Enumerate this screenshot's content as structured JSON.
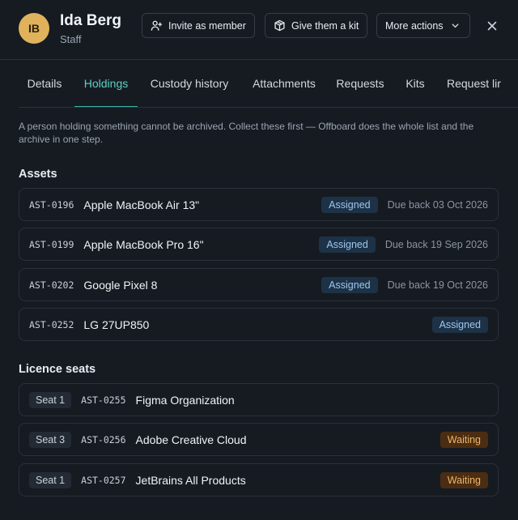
{
  "person": {
    "initials": "IB",
    "name": "Ida Berg",
    "role": "Staff"
  },
  "header": {
    "invite_label": "Invite as member",
    "kit_label": "Give them a kit",
    "more_label": "More actions"
  },
  "tabs": [
    {
      "label": "Details",
      "active": false
    },
    {
      "label": "Holdings",
      "active": true
    },
    {
      "label": "Custody history",
      "active": false
    },
    {
      "label": "Attachments",
      "active": false
    },
    {
      "label": "Requests",
      "active": false
    },
    {
      "label": "Kits",
      "active": false
    },
    {
      "label": "Request lir",
      "active": false
    }
  ],
  "notice": "A person holding something cannot be archived. Collect these first — Offboard does the whole list and the archive in one step.",
  "assets": {
    "title": "Assets",
    "items": [
      {
        "code": "AST-0196",
        "name": "Apple MacBook Air 13\"",
        "status": "Assigned",
        "due": "Due back 03 Oct 2026"
      },
      {
        "code": "AST-0199",
        "name": "Apple MacBook Pro 16\"",
        "status": "Assigned",
        "due": "Due back 19 Sep 2026"
      },
      {
        "code": "AST-0202",
        "name": "Google Pixel 8",
        "status": "Assigned",
        "due": "Due back 19 Oct 2026"
      },
      {
        "code": "AST-0252",
        "name": "LG 27UP850",
        "status": "Assigned",
        "due": ""
      }
    ]
  },
  "licences": {
    "title": "Licence seats",
    "items": [
      {
        "seat": "Seat 1",
        "code": "AST-0255",
        "name": "Figma Organization",
        "status": ""
      },
      {
        "seat": "Seat 3",
        "code": "AST-0256",
        "name": "Adobe Creative Cloud",
        "status": "Waiting"
      },
      {
        "seat": "Seat 1",
        "code": "AST-0257",
        "name": "JetBrains All Products",
        "status": "Waiting"
      }
    ]
  },
  "colors": {
    "accent": "#3fb3a8",
    "assigned_badge": "#1d3247",
    "waiting_badge": "#4a2d12",
    "avatar": "#e0b25c"
  },
  "icons": {
    "invite": "user-plus-icon",
    "kit": "package-icon",
    "more": "chevron-down-icon",
    "close": "close-icon"
  }
}
